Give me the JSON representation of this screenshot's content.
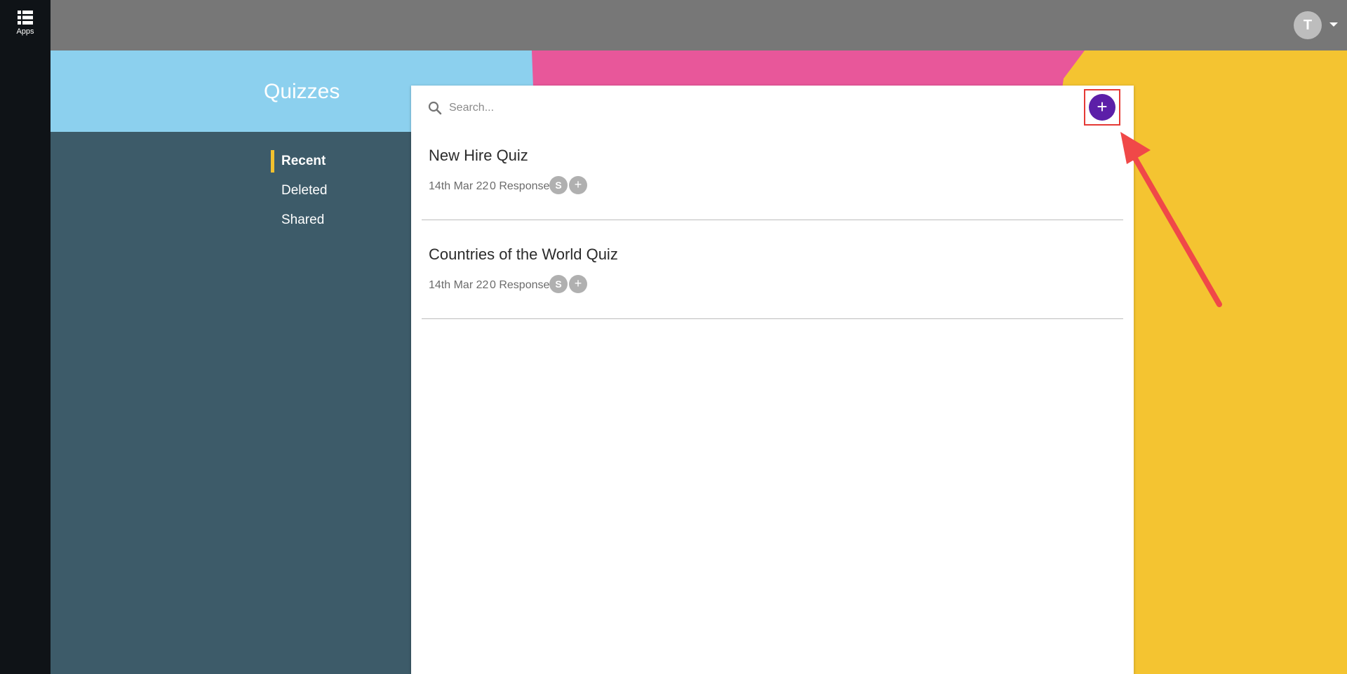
{
  "rail": {
    "apps_label": "Apps",
    "apps_icon": "apps-grid-icon"
  },
  "header": {
    "avatar_initial": "T",
    "avatar_menu_icon": "caret-down-icon"
  },
  "page": {
    "title": "Quizzes"
  },
  "nav": {
    "items": [
      {
        "label": "Recent",
        "active": true
      },
      {
        "label": "Deleted",
        "active": false
      },
      {
        "label": "Shared",
        "active": false
      }
    ]
  },
  "search": {
    "placeholder": "Search...",
    "value": "",
    "icon": "search-icon"
  },
  "toolbar": {
    "add_label": "+"
  },
  "quizzes": [
    {
      "title": "New Hire Quiz",
      "date": "14th Mar 22",
      "responses": "0 Responses",
      "chips": [
        "S",
        "+"
      ]
    },
    {
      "title": "Countries of the World Quiz",
      "date": "14th Mar 22",
      "responses": "0 Responses",
      "chips": [
        "S",
        "+"
      ]
    }
  ],
  "colors": {
    "rail": "#0f1317",
    "topbar": "#777777",
    "accent": "#5c1fa8",
    "nav_indicator": "#f2c12e",
    "highlight": "#e53935"
  }
}
